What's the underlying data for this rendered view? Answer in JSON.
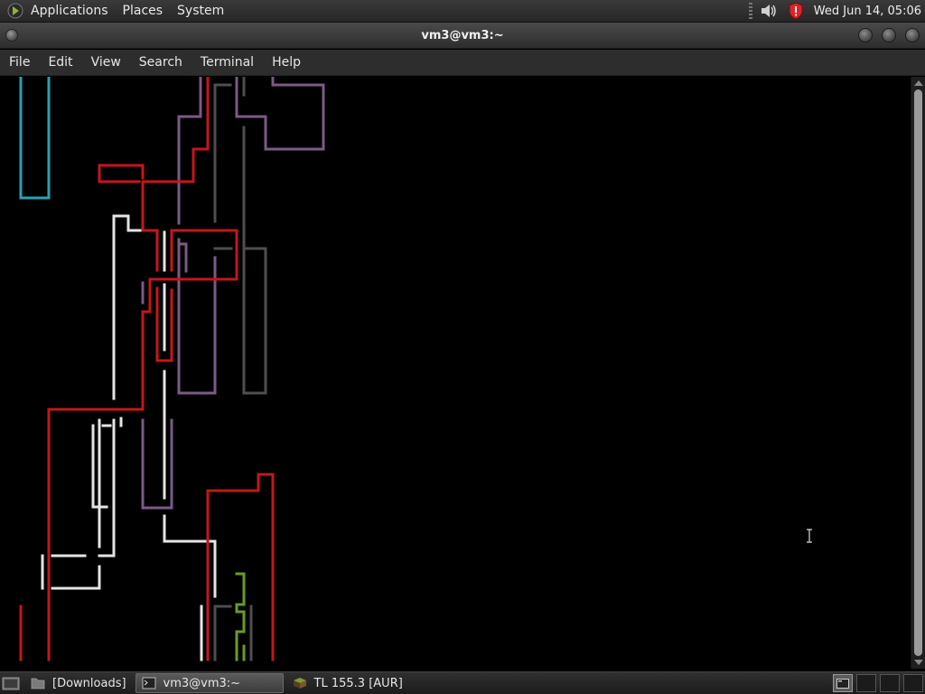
{
  "top_panel": {
    "menus": [
      "Applications",
      "Places",
      "System"
    ],
    "clock": "Wed Jun 14, 05:06",
    "tray_icons": [
      "volume-icon",
      "shield-update-icon"
    ]
  },
  "window": {
    "title": "vm3@vm3:~",
    "buttons": [
      "minimize-icon",
      "maximize-icon",
      "close-icon"
    ]
  },
  "menubar": {
    "items": [
      "File",
      "Edit",
      "View",
      "Search",
      "Terminal",
      "Help"
    ]
  },
  "terminal": {
    "content": "pipes screensaver",
    "pipe_colors": {
      "red": "#c4161c",
      "purple": "#7b5a85",
      "gray": "#4e4e4e",
      "white": "#e4e4e4",
      "teal": "#2aa1b3",
      "green": "#6a9a2a"
    }
  },
  "taskbar": {
    "tasks": [
      {
        "label": "[Downloads]",
        "icon": "folder-icon",
        "active": false
      },
      {
        "label": "vm3@vm3:~",
        "icon": "terminal-icon",
        "active": true
      },
      {
        "label": "TL 155.3 [AUR]",
        "icon": "package-icon",
        "active": false
      }
    ]
  }
}
